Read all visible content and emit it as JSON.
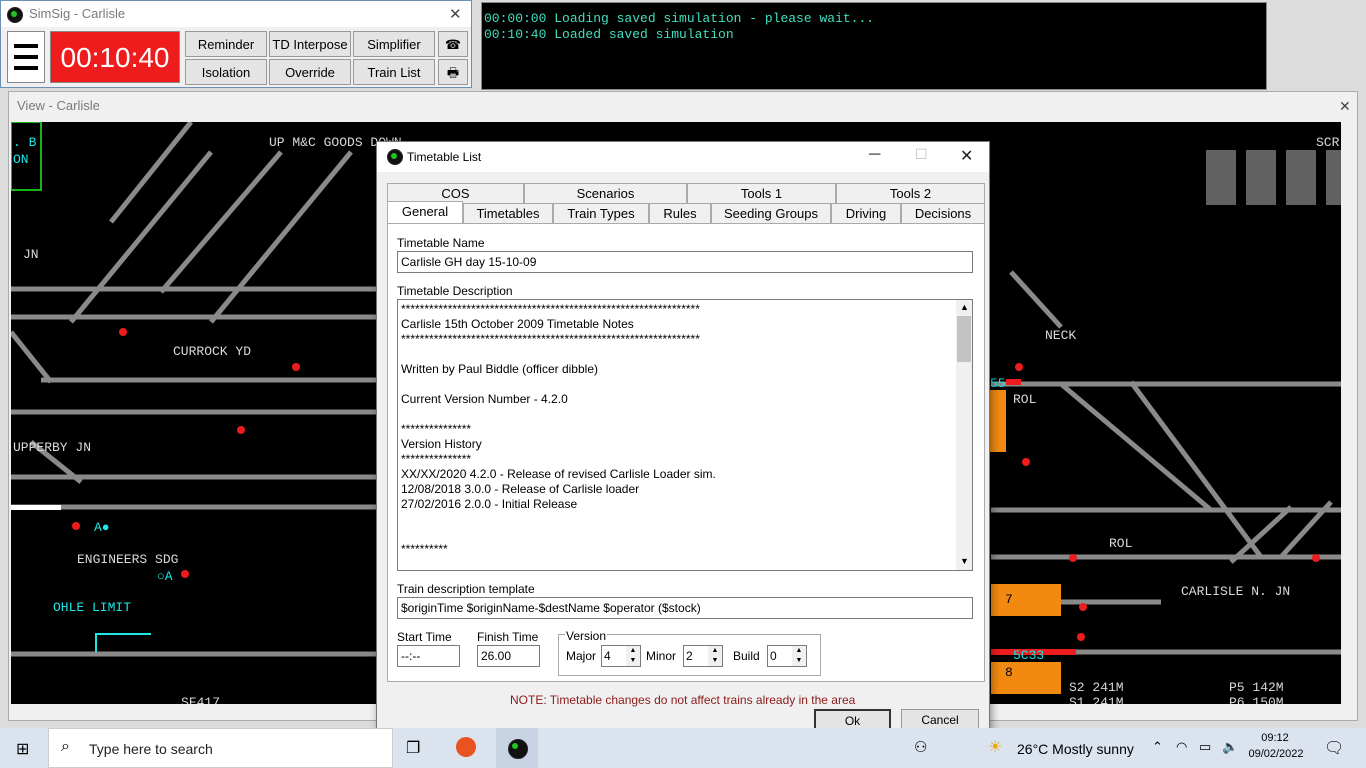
{
  "simsig": {
    "title": "SimSig - Carlisle",
    "close": "✕",
    "clock": "00:10:40",
    "buttons": {
      "reminder": "Reminder",
      "td_interpose": "TD Interpose",
      "simplifier": "Simplifier",
      "isolation": "Isolation",
      "override": "Override",
      "train_list": "Train List"
    }
  },
  "console": {
    "lines": [
      "00:00:00 Loading saved simulation - please wait...",
      "00:10:40 Loaded saved simulation"
    ]
  },
  "view": {
    "title": "View - Carlisle",
    "close": "✕",
    "labels": {
      "up_mc_goods": "UP M&C GOODS DOWN",
      "jn": "JN",
      "currock_yd": "CURROCK YD",
      "upperby_jn": "UPPERBY JN",
      "engineers_sdg": "ENGINEERS SDG",
      "ohle_limit": "OHLE LIMIT",
      "neck": "NECK",
      "rol1": "ROL",
      "rol2": "ROL",
      "carlisle_n_jn": "CARLISLE N. JN",
      "s2": "S2 241M",
      "s1": "S1 241M",
      "p5": "P5 142M",
      "p6": "P6 150M",
      "berth_55": "55",
      "berth_5c33": "5C33",
      "berth_7": "7",
      "berth_8": "8",
      "scr": "SCR",
      "b": ". B",
      "on": "ON",
      "ao": "A●",
      "oa": "○A",
      "sf": "SF417"
    },
    "colors": {
      "background": "#000000",
      "track": "#8a8a8a",
      "label": "#d9d9d9",
      "cyan": "#19e8e8",
      "orange": "#f28a12",
      "red": "#ee1c1c"
    }
  },
  "dialog": {
    "title": "Timetable List",
    "tabs_row1": [
      "COS",
      "Scenarios",
      "Tools 1",
      "Tools 2"
    ],
    "tabs_row2": [
      "General",
      "Timetables",
      "Train Types",
      "Rules",
      "Seeding Groups",
      "Driving",
      "Decisions"
    ],
    "name_label": "Timetable Name",
    "name_value": "Carlisle GH day 15-10-09",
    "description_label": "Timetable Description",
    "description_lines": [
      "****************************************************************",
      "Carlisle 15th October 2009 Timetable Notes",
      "****************************************************************",
      "",
      "Written by Paul Biddle (officer dibble)",
      "",
      "Current Version Number - 4.2.0",
      "",
      "***************",
      "Version History",
      "***************",
      "XX/XX/2020 4.2.0 - Release of revised Carlisle Loader sim.",
      "12/08/2018 3.0.0 - Release of Carlisle loader",
      "27/02/2016 2.0.0 - Initial Release",
      "",
      "",
      "**********"
    ],
    "template_label": "Train description template",
    "template_value": "$originTime $originName-$destName $operator ($stock)",
    "start_label": "Start Time",
    "start_value": "--:--",
    "finish_label": "Finish Time",
    "finish_value": "26.00",
    "version_label": "Version",
    "major_label": "Major",
    "major_value": "4",
    "minor_label": "Minor",
    "minor_value": "2",
    "build_label": "Build",
    "build_value": "0",
    "note": "NOTE: Timetable changes do not affect trains already in the area",
    "ok": "Ok",
    "cancel": "Cancel"
  },
  "taskbar": {
    "search_placeholder": "Type here to search",
    "weather": "26°C  Mostly sunny",
    "time": "09:12",
    "date": "09/02/2022"
  }
}
